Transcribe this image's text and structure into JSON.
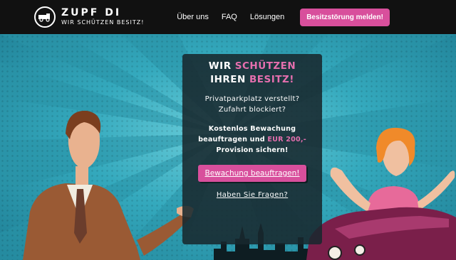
{
  "brand": {
    "name": "ZUPF DI",
    "tagline": "WIR SCHÜTZEN BESITZ!"
  },
  "nav": {
    "items": [
      {
        "label": "Über uns"
      },
      {
        "label": "FAQ"
      },
      {
        "label": "Lösungen"
      }
    ],
    "cta_label": "Besitzstörung melden!"
  },
  "hero": {
    "headline_part1": "WIR ",
    "headline_part2": "SCHÜTZEN",
    "headline_part3": "IHREN ",
    "headline_part4": "BESITZ!",
    "question_line1": "Privatparkplatz verstellt?",
    "question_line2": "Zufahrt blockiert?",
    "offer_line1": "Kostenlos Bewachung",
    "offer_line2a": "beauftragen und ",
    "offer_line2b": "EUR 200,-",
    "offer_line3": "Provision sichern!",
    "button_label": "Bewachung beauftragen!",
    "faq_link": "Haben Sie Fragen?"
  },
  "colors": {
    "accent": "#d84f9c",
    "hero_teal": "#34a9bd",
    "header_bg": "#111111"
  }
}
